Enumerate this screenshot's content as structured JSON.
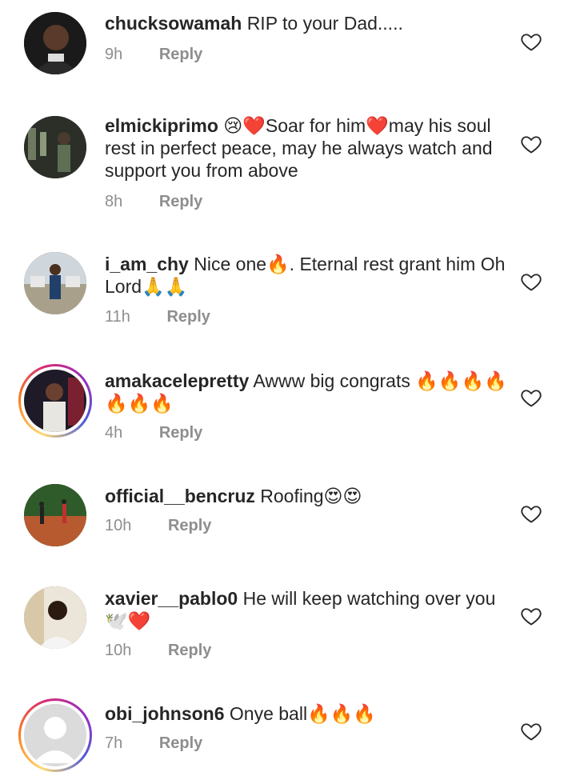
{
  "comments": [
    {
      "username": "chucksowamah",
      "text": "RIP to your Dad.....",
      "time": "9h",
      "reply": "Reply"
    },
    {
      "username": "elmickiprimo",
      "text": "😢❤️Soar for him❤️may his soul rest in perfect peace, may he always watch and support you from above",
      "time": "8h",
      "reply": "Reply"
    },
    {
      "username": "i_am_chy",
      "text": "Nice one🔥. Eternal rest grant him Oh Lord🙏🙏",
      "time": "11h",
      "reply": "Reply"
    },
    {
      "username": "amakacelepretty",
      "text": "Awww big congrats 🔥🔥🔥🔥🔥🔥🔥",
      "time": "4h",
      "reply": "Reply"
    },
    {
      "username": "official__bencruz",
      "text": "Roofing😍😍",
      "time": "10h",
      "reply": "Reply"
    },
    {
      "username": "xavier__pablo0",
      "text": "He will keep watching over you 🕊️❤️",
      "time": "10h",
      "reply": "Reply"
    },
    {
      "username": "obi_johnson6",
      "text": "Onye ball🔥🔥🔥",
      "time": "7h",
      "reply": "Reply"
    }
  ],
  "icons": {
    "like": "heart-outline-icon"
  }
}
